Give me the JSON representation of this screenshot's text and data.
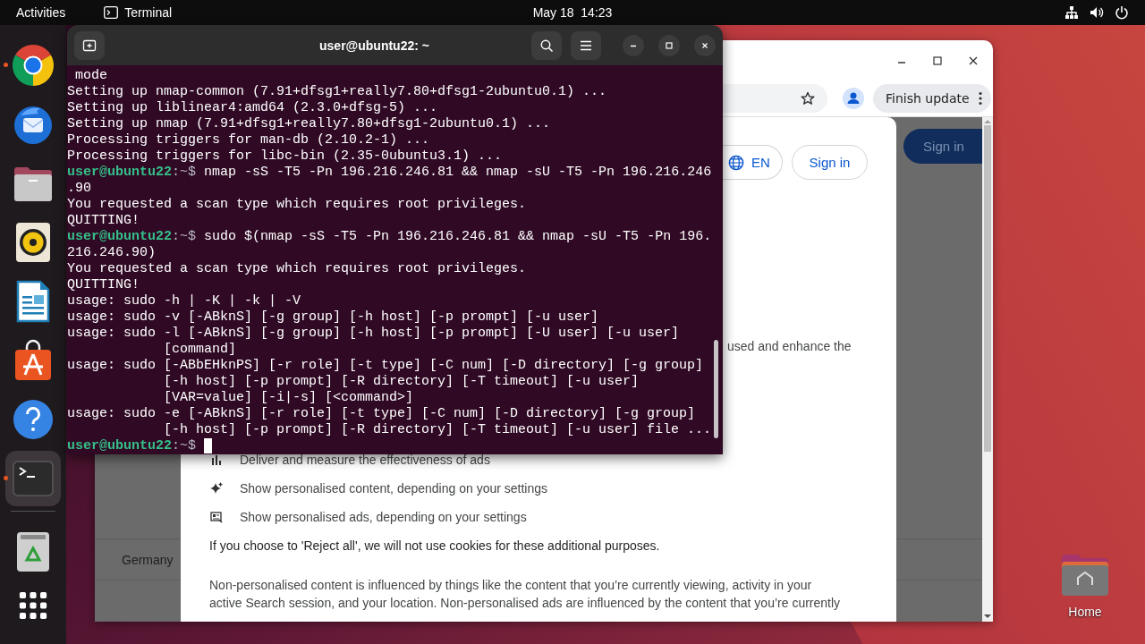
{
  "top_bar": {
    "activities": "Activities",
    "app_name": "Terminal",
    "clock": "May 18  14:23"
  },
  "dock": {
    "items": [
      {
        "kind": "browser",
        "running": true,
        "selected": false
      },
      {
        "kind": "mail",
        "running": false,
        "selected": false
      },
      {
        "kind": "files",
        "running": false,
        "selected": false
      },
      {
        "kind": "music",
        "running": false,
        "selected": false
      },
      {
        "kind": "writer",
        "running": false,
        "selected": false
      },
      {
        "kind": "store",
        "running": false,
        "selected": false
      },
      {
        "kind": "help",
        "running": false,
        "selected": false
      },
      {
        "kind": "terminal",
        "running": true,
        "selected": true
      }
    ]
  },
  "desktop_icons": [
    {
      "label": "Home"
    }
  ],
  "browser": {
    "update_button": "Finish update",
    "page": {
      "behind": {
        "sign_in": "Sign in",
        "country": "Germany"
      },
      "dialog": {
        "language": "EN",
        "sign_in": "Sign in",
        "partial_line": "used and enhance the",
        "purposes": [
          {
            "kind": "measure",
            "text": "Deliver and measure the effectiveness of ads"
          },
          {
            "kind": "content",
            "text": "Show personalised content, depending on your settings"
          },
          {
            "kind": "ads",
            "text": "Show personalised ads, depending on your settings"
          }
        ],
        "reject_note": "If you choose to 'Reject all', we will not use cookies for these additional purposes.",
        "paragraph_lines": [
          "Non-personalised content is influenced by things like the content that you’re currently viewing, activity in your",
          "active Search session, and your location. Non-personalised ads are influenced by the content that you’re currently"
        ]
      }
    }
  },
  "terminal": {
    "title": "user@ubuntu22: ~",
    "lines": [
      {
        "kind": "output",
        "text": " mode"
      },
      {
        "kind": "output",
        "text": "Setting up nmap-common (7.91+dfsg1+really7.80+dfsg1-2ubuntu0.1) ..."
      },
      {
        "kind": "output",
        "text": "Setting up liblinear4:amd64 (2.3.0+dfsg-5) ..."
      },
      {
        "kind": "output",
        "text": "Setting up nmap (7.91+dfsg1+really7.80+dfsg1-2ubuntu0.1) ..."
      },
      {
        "kind": "output",
        "text": "Processing triggers for man-db (2.10.2-1) ..."
      },
      {
        "kind": "output",
        "text": "Processing triggers for libc-bin (2.35-0ubuntu3.1) ..."
      },
      {
        "kind": "prompt",
        "user": "user@ubuntu22",
        "path": ":~$",
        "command": "nmap -sS -T5 -Pn 196.216.246.81 && nmap -sU -T5 -Pn 196.216.246",
        "cursor": false
      },
      {
        "kind": "output",
        "text": ".90"
      },
      {
        "kind": "output",
        "text": "You requested a scan type which requires root privileges."
      },
      {
        "kind": "output",
        "text": "QUITTING!"
      },
      {
        "kind": "prompt",
        "user": "user@ubuntu22",
        "path": ":~$",
        "command": "sudo $(nmap -sS -T5 -Pn 196.216.246.81 && nmap -sU -T5 -Pn 196.",
        "cursor": false
      },
      {
        "kind": "output",
        "text": "216.246.90)"
      },
      {
        "kind": "output",
        "text": "You requested a scan type which requires root privileges."
      },
      {
        "kind": "output",
        "text": "QUITTING!"
      },
      {
        "kind": "output",
        "text": "usage: sudo -h | -K | -k | -V"
      },
      {
        "kind": "output",
        "text": "usage: sudo -v [-ABknS] [-g group] [-h host] [-p prompt] [-u user]"
      },
      {
        "kind": "output",
        "text": "usage: sudo -l [-ABknS] [-g group] [-h host] [-p prompt] [-U user] [-u user]"
      },
      {
        "kind": "output",
        "text": "            [command]"
      },
      {
        "kind": "output",
        "text": "usage: sudo [-ABbEHknPS] [-r role] [-t type] [-C num] [-D directory] [-g group]"
      },
      {
        "kind": "output",
        "text": "            [-h host] [-p prompt] [-R directory] [-T timeout] [-u user]"
      },
      {
        "kind": "output",
        "text": "            [VAR=value] [-i|-s] [<command>]"
      },
      {
        "kind": "output",
        "text": "usage: sudo -e [-ABknS] [-r role] [-t type] [-C num] [-D directory] [-g group]"
      },
      {
        "kind": "output",
        "text": "            [-h host] [-p prompt] [-R directory] [-T timeout] [-u user] file ..."
      },
      {
        "kind": "prompt",
        "user": "user@ubuntu22",
        "path": ":~$",
        "cursor": true
      }
    ]
  }
}
